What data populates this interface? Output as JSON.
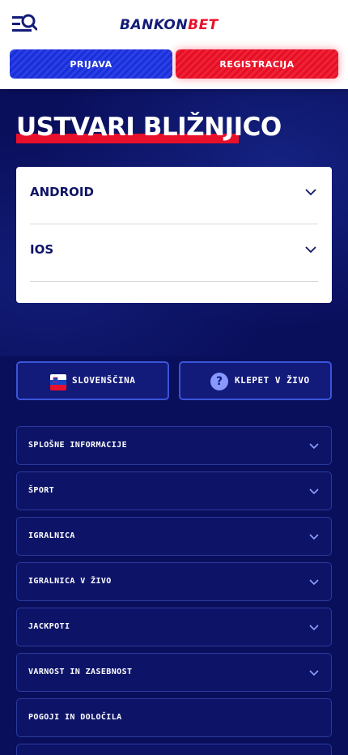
{
  "header": {
    "logo_part1": "BANKON",
    "logo_part2": "BET",
    "login_label": "PRIJAVA",
    "register_label": "REGISTRACIJA",
    "menu_icon": "menu-search-icon"
  },
  "page": {
    "title": "USTVARI BLIŽNJICO"
  },
  "platforms": [
    {
      "label": "ANDROID"
    },
    {
      "label": "IOS"
    }
  ],
  "footer_buttons": {
    "language_label": "SLOVENŠČINA",
    "chat_label": "KLEPET V ŽIVO",
    "chat_icon_glyph": "?"
  },
  "accordion": [
    {
      "label": "SPLOŠNE INFORMACIJE"
    },
    {
      "label": "ŠPORT"
    },
    {
      "label": "IGRALNICA"
    },
    {
      "label": "IGRALNICA V ŽIVO"
    },
    {
      "label": "JACKPOTI"
    },
    {
      "label": "VARNOST IN ZASEBNOST"
    },
    {
      "label": "POGOJI IN DOLOČILA"
    },
    {
      "label": ""
    }
  ],
  "colors": {
    "background": "#0a0f5c",
    "brand_blue": "#131c78",
    "brand_red": "#e8102a",
    "login_blue": "#1a2fd6"
  }
}
